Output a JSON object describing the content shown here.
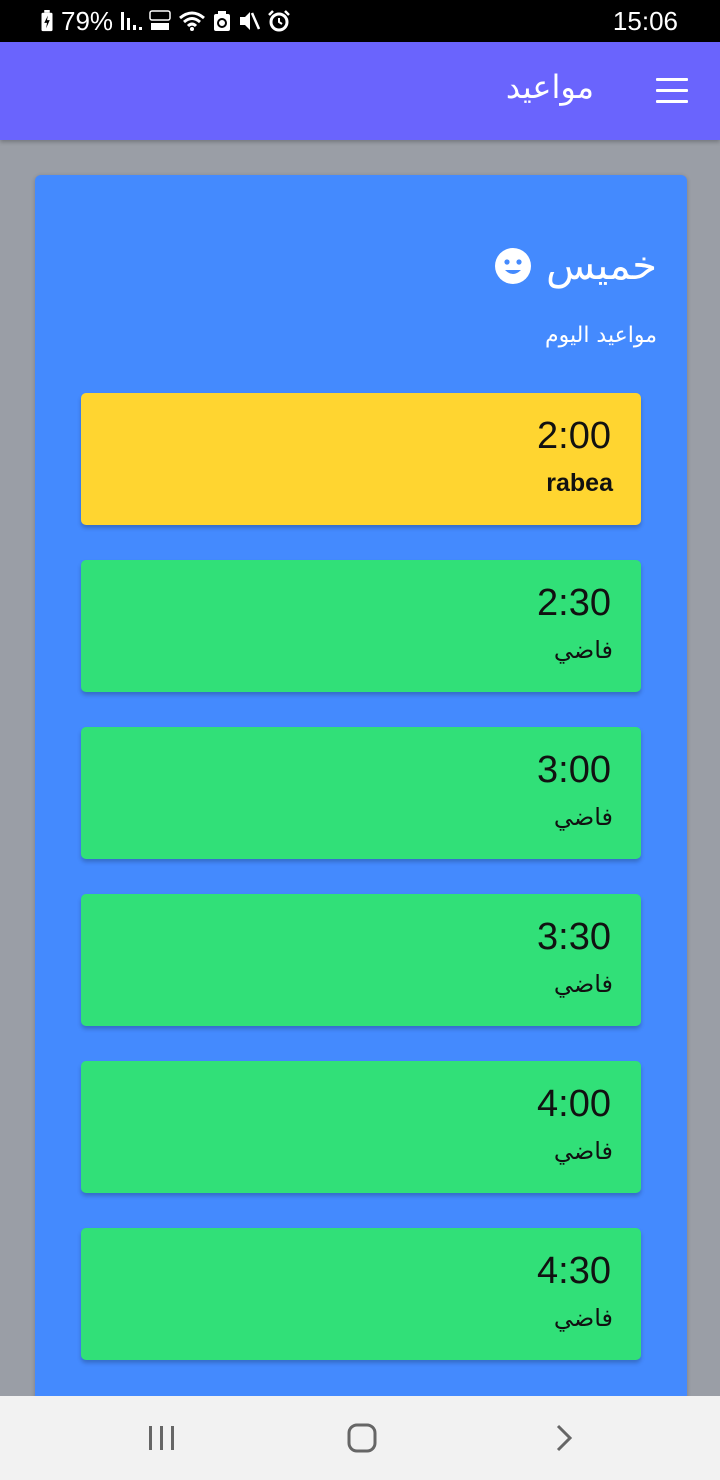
{
  "status_bar": {
    "battery_percent": "79%",
    "time": "15:06"
  },
  "app_bar": {
    "title": "مواعيد",
    "menu_icon": "hamburger-menu-icon",
    "background": "#6a64fd"
  },
  "day_card": {
    "day": "خميس",
    "day_icon": "smiley-face-icon",
    "subtitle": "مواعيد اليوم",
    "background": "#448afe"
  },
  "slots": [
    {
      "time": "2:00",
      "label": "rabea",
      "status": "booked",
      "color": "#ffd530"
    },
    {
      "time": "2:30",
      "label": "فاضي",
      "status": "free",
      "color": "#31e078"
    },
    {
      "time": "3:00",
      "label": "فاضي",
      "status": "free",
      "color": "#31e078"
    },
    {
      "time": "3:30",
      "label": "فاضي",
      "status": "free",
      "color": "#31e078"
    },
    {
      "time": "4:00",
      "label": "فاضي",
      "status": "free",
      "color": "#31e078"
    },
    {
      "time": "4:30",
      "label": "فاضي",
      "status": "free",
      "color": "#31e078"
    }
  ],
  "nav_bar": {
    "buttons": [
      "recent-apps-icon",
      "home-icon",
      "back-icon"
    ]
  }
}
